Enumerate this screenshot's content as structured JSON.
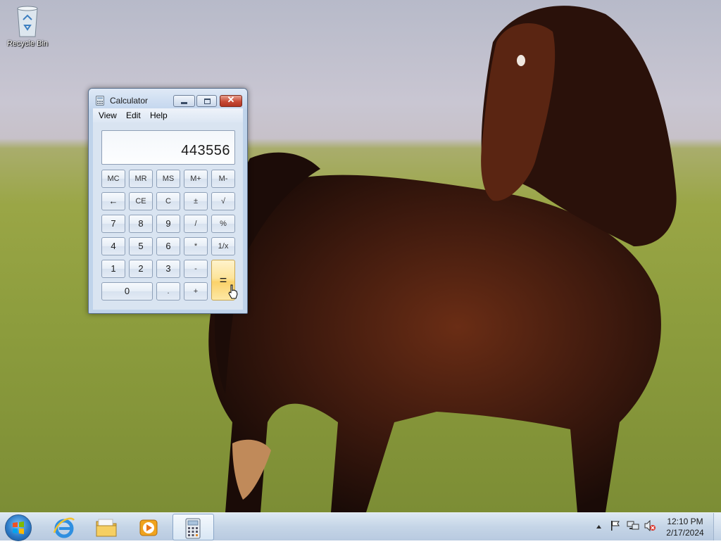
{
  "desktop": {
    "icons": [
      {
        "label": "Recycle Bin",
        "icon": "recycle-bin-icon"
      }
    ]
  },
  "calculator": {
    "title": "Calculator",
    "menu": [
      "View",
      "Edit",
      "Help"
    ],
    "display_value": "443556",
    "rows": [
      [
        "MC",
        "MR",
        "MS",
        "M+",
        "M-"
      ],
      [
        "←",
        "CE",
        "C",
        "±",
        "√"
      ],
      [
        "7",
        "8",
        "9",
        "/",
        "%"
      ],
      [
        "4",
        "5",
        "6",
        "*",
        "1/x"
      ],
      [
        "1",
        "2",
        "3",
        "-",
        "="
      ],
      [
        "0",
        ".",
        "+"
      ]
    ]
  },
  "taskbar": {
    "apps": [
      "start-button",
      "internet-explorer-icon",
      "file-explorer-icon",
      "media-player-icon",
      "calculator-icon"
    ],
    "tray": [
      "show-hidden-icons-icon",
      "action-center-flag-icon",
      "network-icon",
      "volume-muted-icon"
    ],
    "time": "12:10 PM",
    "date": "2/17/2024"
  },
  "colors": {
    "equals_key": "#fde49a",
    "close_button": "#c74a36"
  }
}
